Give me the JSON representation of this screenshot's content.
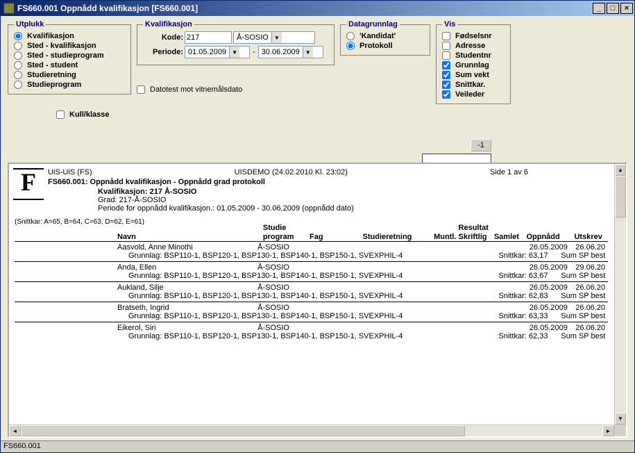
{
  "window": {
    "title": "FS660.001 Oppnådd kvalifikasjon [FS660.001]"
  },
  "utplukk": {
    "legend": "Utplukk",
    "opts": {
      "kvalifikasjon": "Kvalifikasjon",
      "sted_kval": "Sted - kvalifikasjon",
      "sted_prog": "Sted - studieprogram",
      "sted_stud": "Sted - student",
      "studieretning": "Studieretning",
      "studieprogram": "Studieprogram"
    },
    "kull_klasse": "Kull/klasse"
  },
  "kvalifikasjon": {
    "legend": "Kvalifikasjon",
    "kode_label": "Kode:",
    "kode_val": "217",
    "kode_sel": "Å-SOSIO",
    "periode_label": "Periode:",
    "periode_from": "01.05.2009",
    "periode_to": "30.06.2009",
    "datotest": "Datotest mot vitnemålsdato"
  },
  "datagrunnlag": {
    "legend": "Datagrunnlag",
    "kandidat": "'Kandidat'",
    "protokoll": "Protokoll"
  },
  "vis": {
    "legend": "Vis",
    "fodselsnr": "Fødselsnr",
    "adresse": "Adresse",
    "studentnr": "Studentnr",
    "grunnlag": "Grunnlag",
    "sumvekt": "Sum vekt",
    "snittkar": "Snittkar.",
    "veileder": "Veileder"
  },
  "small_btn": "-1",
  "report": {
    "org": "UiS-UiS  (FS)",
    "center": "UISDEMO   (24.02.2010 Kl. 23:02)",
    "page": "Side 1 av 6",
    "title": "FS660.001: Oppnådd kvalifikasjon  - Oppnådd grad protokoll",
    "kval_line": "Kvalifikasjon: 217 Å-SOSIO",
    "grad_line": "Grad: 217-Å-SOSIO",
    "periode_line": "Periode for oppnådd kvalifikasjon.: 01.05.2009 - 30.06.2009 (oppnådd dato)",
    "legend": "(Snittkar: A=65, B=64, C=63, D=62, E=61)",
    "headers": {
      "navn": "Navn",
      "studieprog_top": "Studie",
      "studieprog_bot": "program",
      "fag": "Fag",
      "studieretning": "Studieretning",
      "muntl": "Muntl.",
      "resultat": "Resultat",
      "skriftlig": "Skriftlig",
      "samlet": "Samlet",
      "oppnadd": "Oppnådd",
      "utskrev": "Utskrev"
    },
    "students": [
      {
        "navn": "Aasvold, Anne Minothi",
        "prog": "Å-SOSIO",
        "d1": "26.05.2009",
        "d2": "26.06.20",
        "grunnlag": "Grunnlag: BSP110-1, BSP120-1, BSP130-1, BSP140-1, BSP150-1, SVEXPHIL-4",
        "snitt": "Snittkar: 63,17",
        "sp": "Sum SP best"
      },
      {
        "navn": "Anda, Ellen",
        "prog": "Å-SOSIO",
        "d1": "26.05.2009",
        "d2": "29.06.20",
        "grunnlag": "Grunnlag: BSP110-1, BSP120-1, BSP130-1, BSP140-1, BSP150-1, SVEXPHIL-4",
        "snitt": "Snittkar: 63,67",
        "sp": "Sum SP best"
      },
      {
        "navn": "Aukland, Silje",
        "prog": "Å-SOSIO",
        "d1": "26.05.2009",
        "d2": "26.06.20",
        "grunnlag": "Grunnlag: BSP110-1, BSP120-1, BSP130-1, BSP140-1, BSP150-1, SVEXPHIL-4",
        "snitt": "Snittkar: 62,83",
        "sp": "Sum SP best"
      },
      {
        "navn": "Bratseth, Ingrid",
        "prog": "Å-SOSIO",
        "d1": "26.05.2009",
        "d2": "26.06.20",
        "grunnlag": "Grunnlag: BSP110-1, BSP120-1, BSP130-1, BSP140-1, BSP150-1, SVEXPHIL-4",
        "snitt": "Snittkar: 63,33",
        "sp": "Sum SP best"
      },
      {
        "navn": "Eikerol, Siri",
        "prog": "Å-SOSIO",
        "d1": "26.05.2009",
        "d2": "26.06.20",
        "grunnlag": "Grunnlag: BSP110-1, BSP120-1, BSP130-1, BSP140-1, BSP150-1, SVEXPHIL-4",
        "snitt": "Snittkar: 62,33",
        "sp": "Sum SP best"
      }
    ]
  },
  "status": "FS660.001"
}
